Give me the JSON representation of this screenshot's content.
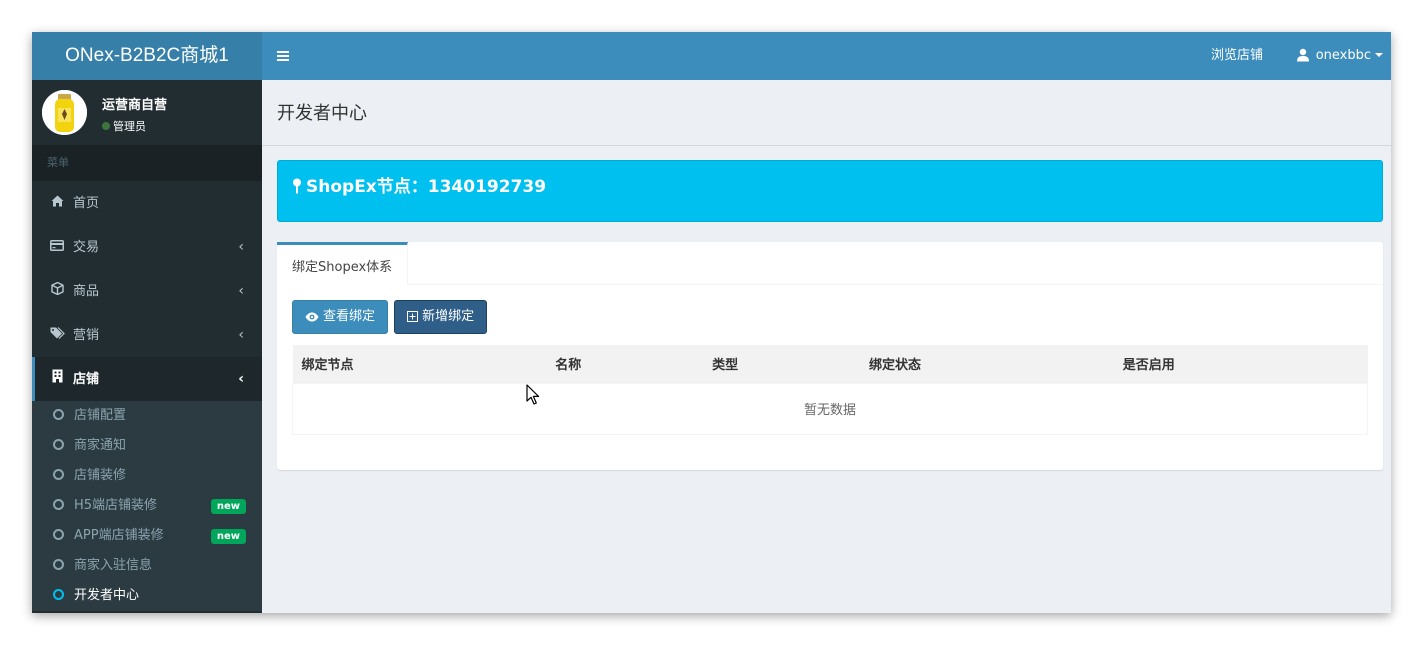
{
  "brand": {
    "title": "ONex-B2B2C商城1"
  },
  "user_panel": {
    "name": "运营商自营",
    "role": "管理员"
  },
  "sidebar": {
    "header": "菜单",
    "items": [
      {
        "label": "首页",
        "icon": "home-icon"
      },
      {
        "label": "交易",
        "icon": "credit-card-icon"
      },
      {
        "label": "商品",
        "icon": "cube-icon"
      },
      {
        "label": "营销",
        "icon": "tags-icon"
      },
      {
        "label": "店铺",
        "icon": "building-icon"
      }
    ],
    "sub_items": [
      {
        "label": "店铺配置"
      },
      {
        "label": "商家通知"
      },
      {
        "label": "店铺装修"
      },
      {
        "label": "H5端店铺装修",
        "badge": "new"
      },
      {
        "label": "APP端店铺装修",
        "badge": "new"
      },
      {
        "label": "商家入驻信息"
      },
      {
        "label": "开发者中心"
      }
    ]
  },
  "topbar": {
    "toggle_icon": "bars-icon",
    "browse": "浏览店铺",
    "username": "onexbbc"
  },
  "page": {
    "title": "开发者中心"
  },
  "callout": {
    "text": "ShopEx节点：1340192739"
  },
  "tabs": [
    {
      "label": "绑定Shopex体系"
    }
  ],
  "buttons": {
    "view": "查看绑定",
    "add": "新增绑定"
  },
  "table": {
    "columns": [
      "绑定节点",
      "名称",
      "类型",
      "绑定状态",
      "是否启用"
    ],
    "empty": "暂无数据"
  },
  "colors": {
    "accent": "#3c8dbc",
    "callout": "#00c0ef",
    "badge_new": "#00a65a",
    "sidebar": "#222d32"
  }
}
